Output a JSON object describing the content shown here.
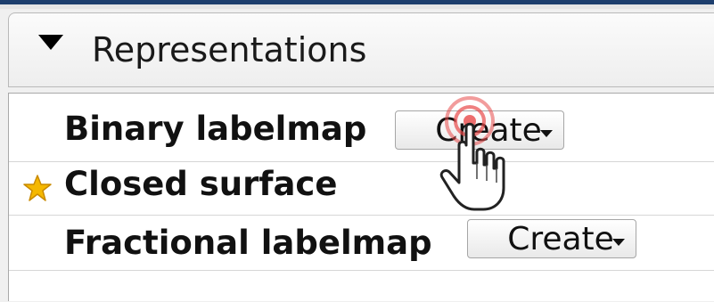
{
  "section": {
    "title": "Representations",
    "expanded": true
  },
  "representations": [
    {
      "name": "Binary labelmap",
      "has_create_button": true,
      "create_label": "Create",
      "is_master": false
    },
    {
      "name": "Closed surface",
      "has_create_button": false,
      "is_master": true
    },
    {
      "name": "Fractional labelmap",
      "has_create_button": true,
      "create_label": "Create",
      "is_master": false
    }
  ],
  "colors": {
    "title_bar": "#1e3f6e",
    "master_star": "#f5b800",
    "click_indicator": "#e84a4a"
  }
}
